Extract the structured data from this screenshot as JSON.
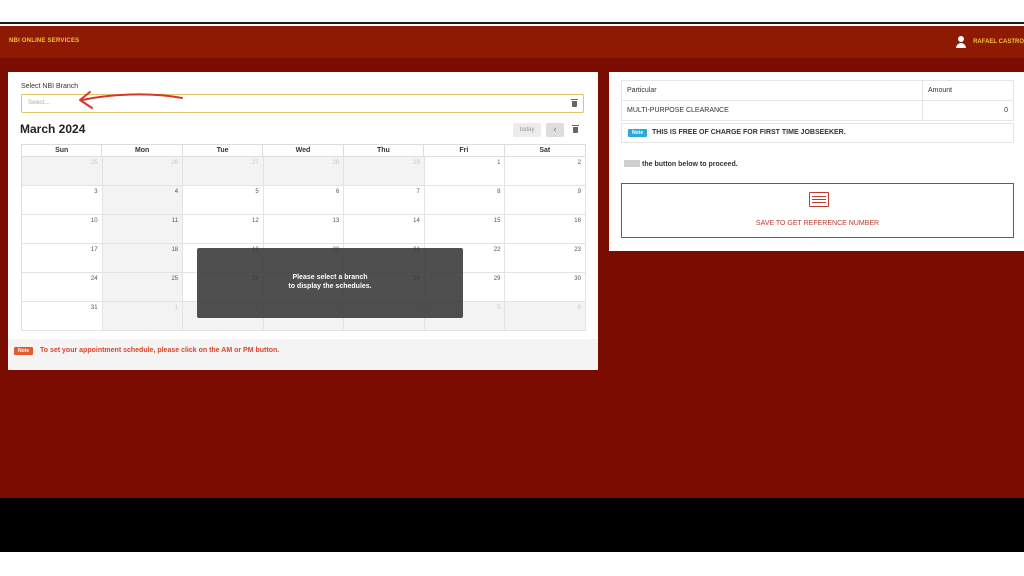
{
  "header": {
    "brand": "NBI ONLINE SERVICES",
    "user_name": "RAFAEL CASTRO"
  },
  "branch": {
    "label": "Select NBI Branch",
    "placeholder": "Select..."
  },
  "calendar": {
    "title": "March 2024",
    "today_label": "today",
    "prev_label": "‹",
    "weekdays": [
      "Sun",
      "Mon",
      "Tue",
      "Wed",
      "Thu",
      "Fri",
      "Sat"
    ],
    "weeks": [
      [
        "25",
        "26",
        "27",
        "28",
        "29",
        "1",
        "2"
      ],
      [
        "3",
        "4",
        "5",
        "6",
        "7",
        "8",
        "9"
      ],
      [
        "10",
        "11",
        "12",
        "13",
        "14",
        "15",
        "16"
      ],
      [
        "17",
        "18",
        "19",
        "20",
        "21",
        "22",
        "23"
      ],
      [
        "24",
        "25",
        "26",
        "27",
        "28",
        "29",
        "30"
      ],
      [
        "31",
        "1",
        "2",
        "3",
        "4",
        "5",
        "6"
      ]
    ],
    "overlay_line1": "Please select a branch",
    "overlay_line2": "to display the schedules."
  },
  "appointment_note": {
    "badge": "Note",
    "text": "To set your appointment schedule, please click on the AM or PM button."
  },
  "payment": {
    "col_particular": "Particular",
    "col_amount": "Amount",
    "item": "MULTI-PURPOSE CLEARANCE",
    "amount": "0",
    "free_badge": "Note",
    "free_text": "THIS IS FREE OF CHARGE FOR FIRST TIME JOBSEEKER.",
    "proceed_text": "the button below to proceed.",
    "save_label": "SAVE TO GET REFERENCE NUMBER"
  },
  "colors": {
    "header": "#8f1a03",
    "page_bg": "#7a0c02",
    "brand_text": "#f3c23b",
    "accent_red": "#c0392b",
    "note_orange": "#e35a2c",
    "note_blue": "#2aa9dc"
  },
  "icons": {
    "user": "user-icon",
    "clear": "trash-icon",
    "save": "card-icon",
    "annotation": "red-arrow-icon"
  }
}
